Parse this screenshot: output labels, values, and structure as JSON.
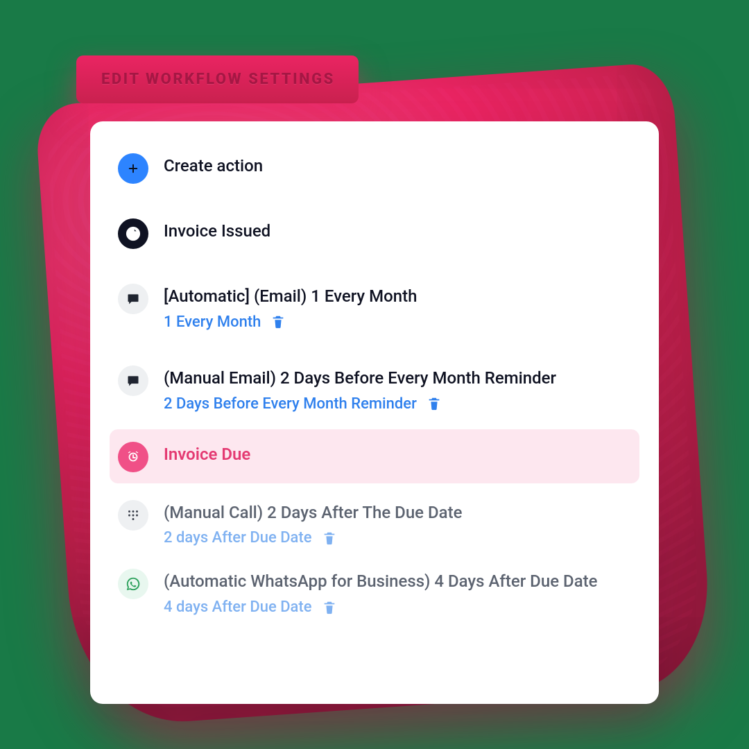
{
  "cta": {
    "label": "EDIT WORKFLOW SETTINGS"
  },
  "rows": [
    {
      "icon": "plus-icon",
      "title": "Create action"
    },
    {
      "icon": "document-icon",
      "title": "Invoice Issued"
    },
    {
      "icon": "message-icon",
      "title": "[Automatic] (Email) 1 Every Month",
      "sub": "1 Every Month"
    },
    {
      "icon": "message-icon",
      "title": "(Manual Email) 2 Days Before Every Month Reminder",
      "sub": "2 Days Before Every Month Reminder"
    },
    {
      "icon": "alarm-icon",
      "title": "Invoice Due",
      "highlight": true
    },
    {
      "icon": "keypad-icon",
      "title": "(Manual Call) 2 Days After The Due Date",
      "sub": "2 days After Due Date"
    },
    {
      "icon": "whatsapp-icon",
      "title": "(Automatic WhatsApp for Business) 4 Days After Due Date",
      "sub": "4 days After Due Date"
    }
  ],
  "colors": {
    "page_bg": "#197a47",
    "card_bg": "#ffffff",
    "text": "#0f1222",
    "muted": "#5c6370",
    "link": "#2f80ed",
    "link_soft": "#7fb1f1",
    "pink": "#ea2462",
    "pink_soft": "#fde7ef",
    "pink_accent": "#f05087",
    "grey_chip": "#eef0f2",
    "green_soft": "#e8f7ef"
  }
}
